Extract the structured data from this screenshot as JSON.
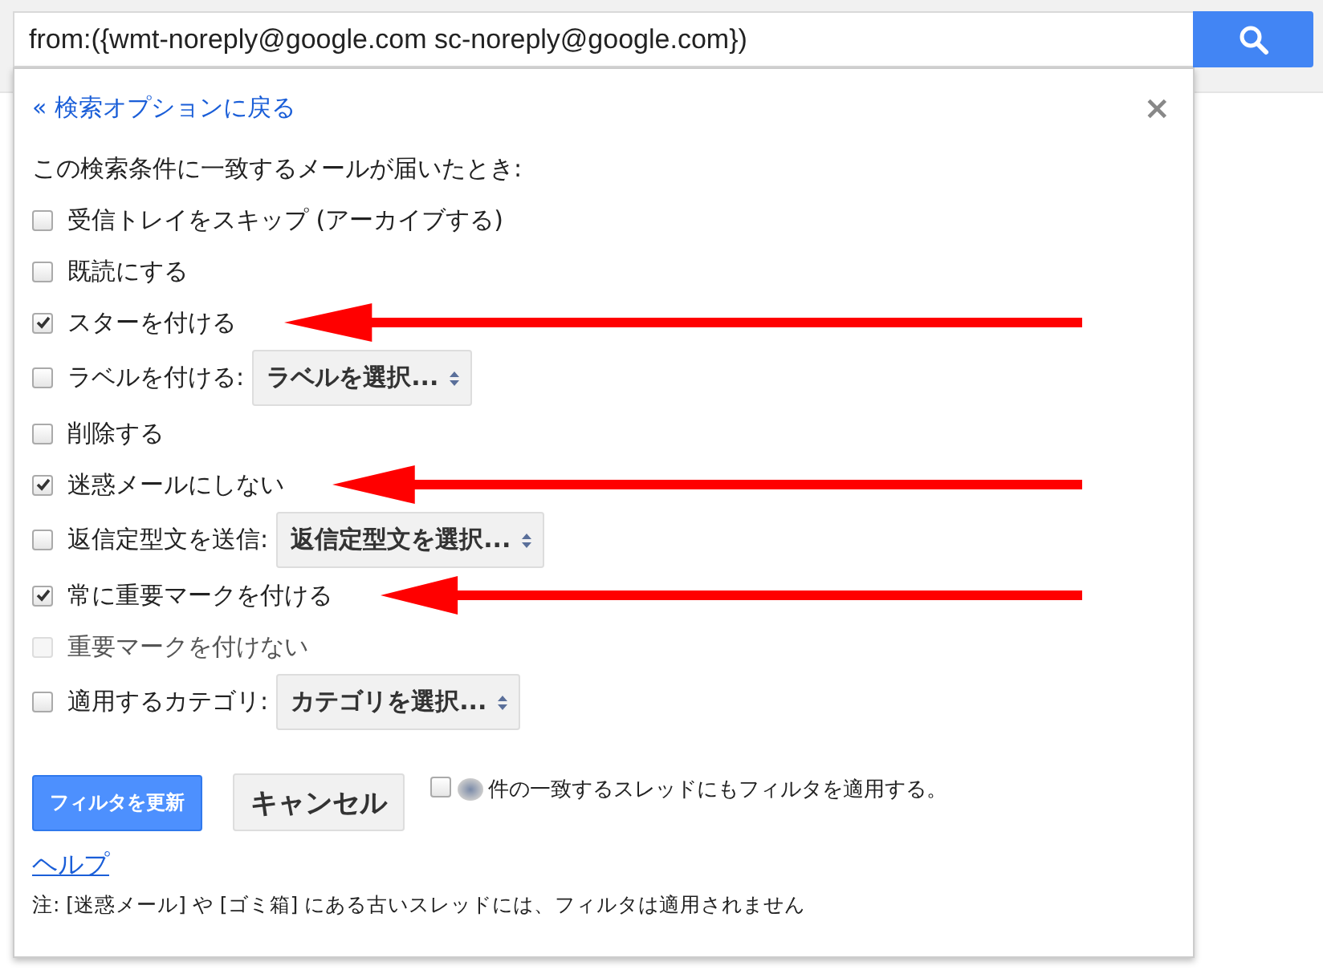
{
  "search": {
    "value": "from:({wmt-noreply@google.com sc-noreply@google.com})"
  },
  "panel": {
    "back_link": "« 検索オプションに戻る",
    "close": "×",
    "heading": "この検索条件に一致するメールが届いたとき:",
    "options": [
      {
        "kind": "checkbox",
        "label": "受信トレイをスキップ (アーカイブする)",
        "checked": false,
        "disabled": false,
        "arrow": false
      },
      {
        "kind": "checkbox",
        "label": "既読にする",
        "checked": false,
        "disabled": false,
        "arrow": false
      },
      {
        "kind": "checkbox",
        "label": "スターを付ける",
        "checked": true,
        "disabled": false,
        "arrow": true
      },
      {
        "kind": "select",
        "label": "ラベルを付ける:",
        "select": "ラベルを選択...",
        "checked": false,
        "disabled": false,
        "arrow": false
      },
      {
        "kind": "checkbox",
        "label": "削除する",
        "checked": false,
        "disabled": false,
        "arrow": false
      },
      {
        "kind": "checkbox",
        "label": "迷惑メールにしない",
        "checked": true,
        "disabled": false,
        "arrow": true
      },
      {
        "kind": "select",
        "label": "返信定型文を送信:",
        "select": "返信定型文を選択...",
        "checked": false,
        "disabled": false,
        "arrow": false
      },
      {
        "kind": "checkbox",
        "label": "常に重要マークを付ける",
        "checked": true,
        "disabled": false,
        "arrow": true
      },
      {
        "kind": "checkbox",
        "label": "重要マークを付けない",
        "checked": false,
        "disabled": true,
        "arrow": false
      },
      {
        "kind": "select",
        "label": "適用するカテゴリ:",
        "select": "カテゴリを選択...",
        "checked": false,
        "disabled": false,
        "arrow": false
      }
    ],
    "update_button": "フィルタを更新",
    "cancel_button": "キャンセル",
    "apply_existing": {
      "label": "件の一致するスレッドにもフィルタを適用する。",
      "checked": false
    },
    "help_link": "ヘルプ",
    "note": "注: [迷惑メール] や [ゴミ箱] にある古いスレッドには、フィルタは適用されません"
  }
}
